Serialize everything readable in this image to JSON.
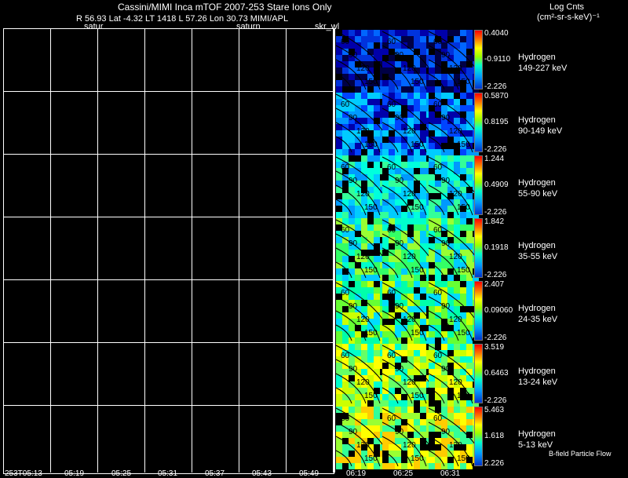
{
  "header": {
    "title": "Cassini/MIMI Inca mTOF   2007-253   Stare    Ions Only",
    "info": "R       56.93 Lat -4.32 LT 1418 L         57.26 Lon       30.73  MIMI/APL",
    "log_title": "Log Cnts",
    "log_units": "(cm²-sr-s-keV)⁻¹"
  },
  "panel_tags": {
    "saturn1": "satur",
    "saturn2": "saturn",
    "skr": "skr_wl"
  },
  "time_axis": [
    "253T05:13",
    "05:19",
    "05:25",
    "05:31",
    "05:37",
    "05:43",
    "05:49",
    "06:19",
    "06:25",
    "06:31"
  ],
  "flow_label": "B-field Particle Flow",
  "energy_bands": [
    {
      "species": "Hydrogen",
      "range": "149-227 keV",
      "max": "0.4040",
      "mid": "-0.9110",
      "min": "-2.226"
    },
    {
      "species": "Hydrogen",
      "range": "90-149 keV",
      "max": "0.5870",
      "mid": "0.8195",
      "min": "-2.226"
    },
    {
      "species": "Hydrogen",
      "range": "55-90 keV",
      "max": "1.244",
      "mid": "0.4909",
      "min": "-2.226"
    },
    {
      "species": "Hydrogen",
      "range": "35-55 keV",
      "max": "1.842",
      "mid": "0.1918",
      "min": "-2.226"
    },
    {
      "species": "Hydrogen",
      "range": "24-35 keV",
      "max": "2.407",
      "mid": "0.09060",
      "min": "-2.226"
    },
    {
      "species": "Hydrogen",
      "range": "13-24 keV",
      "max": "3.519",
      "mid": "0.6463",
      "min": "-2.226"
    },
    {
      "species": "Hydrogen",
      "range": "5-13 keV",
      "max": "5.463",
      "mid": "1.618",
      "min": "2.226"
    }
  ],
  "pitch_labels": [
    "60",
    "90",
    "120",
    "150"
  ]
}
